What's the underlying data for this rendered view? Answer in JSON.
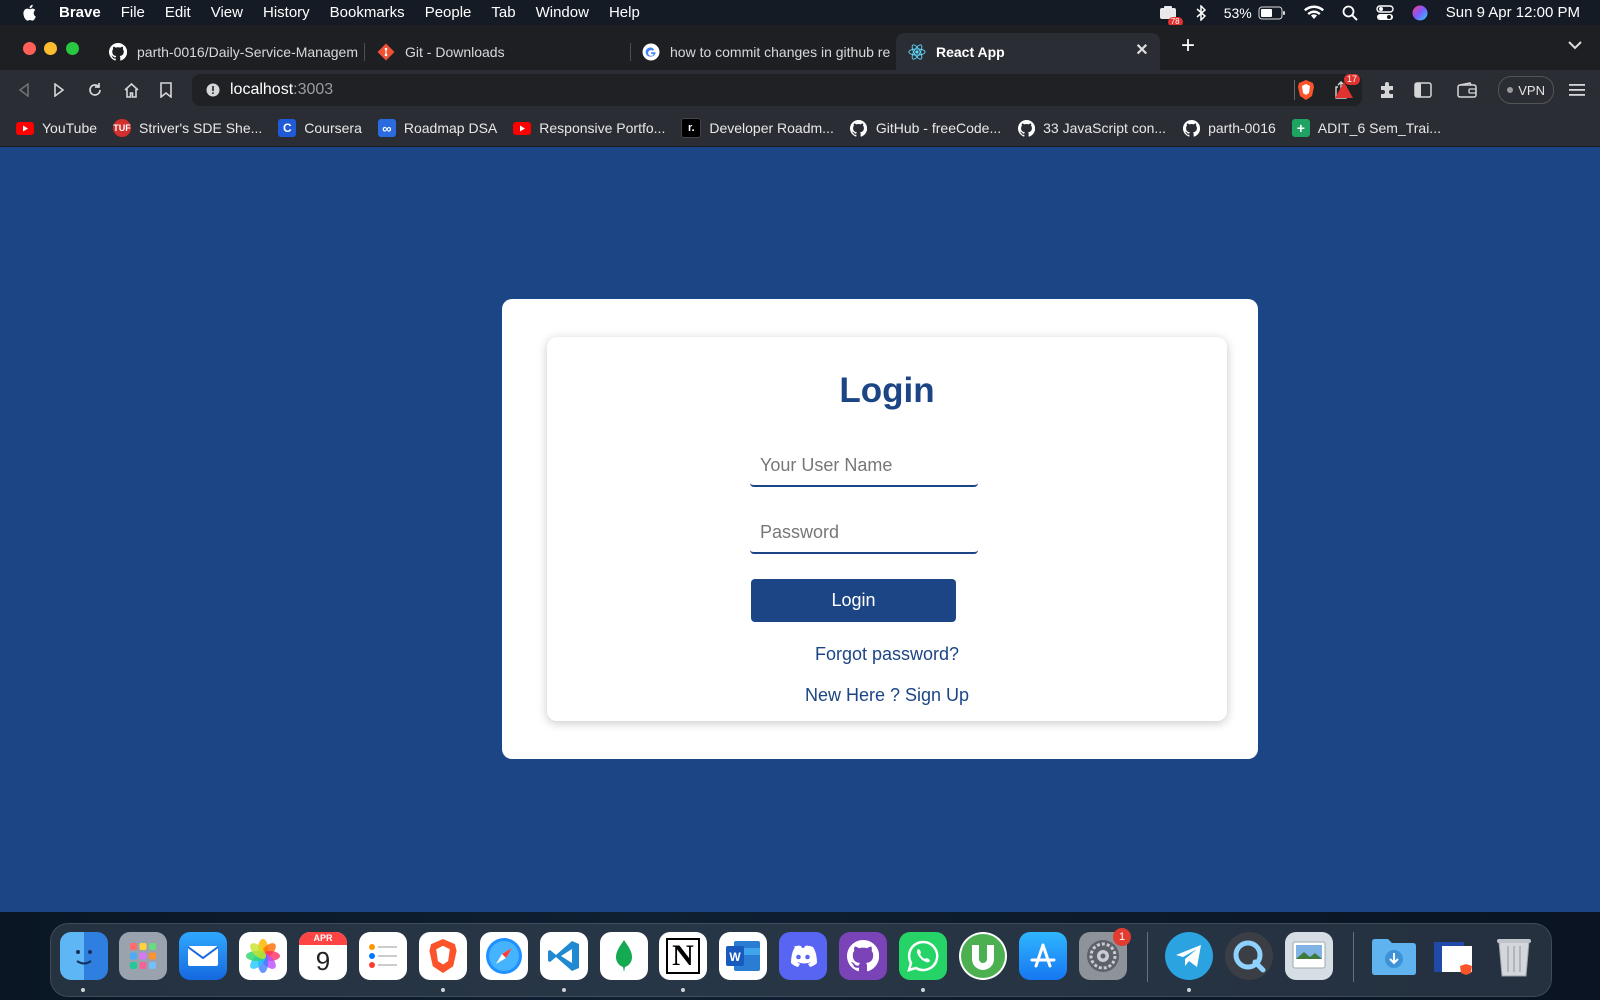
{
  "menubar": {
    "app_name": "Brave",
    "items": [
      "File",
      "Edit",
      "View",
      "History",
      "Bookmarks",
      "People",
      "Tab",
      "Window",
      "Help"
    ],
    "battery_percent": "53%",
    "clock": "Sun 9 Apr  12:00 PM",
    "notification_badge": "78"
  },
  "tabs": [
    {
      "title": "parth-0016/Daily-Service-Managem",
      "icon": "github-icon"
    },
    {
      "title": "Git - Downloads",
      "icon": "git-icon"
    },
    {
      "title": "how to commit changes in github re",
      "icon": "google-icon"
    },
    {
      "title": "React App",
      "icon": "react-icon",
      "active": true
    }
  ],
  "toolbar": {
    "url_host": "localhost",
    "url_port": ":3003",
    "shields_badge": "17",
    "vpn_label": "VPN"
  },
  "bookmarks": [
    {
      "label": "YouTube",
      "icon": "youtube-icon",
      "color": "#ff0000"
    },
    {
      "label": "Striver's SDE She...",
      "icon": "tuf-icon",
      "color": "#d32f2f",
      "icon_text": "TUF"
    },
    {
      "label": "Coursera",
      "icon": "coursera-icon",
      "color": "#1f5bd6",
      "icon_text": "C"
    },
    {
      "label": "Roadmap DSA",
      "icon": "infinity-icon",
      "color": "#2a6be0",
      "icon_text": "∞"
    },
    {
      "label": "Responsive Portfo...",
      "icon": "youtube-icon",
      "color": "#ff0000"
    },
    {
      "label": "Developer Roadm...",
      "icon": "roadmap-icon",
      "color": "#000000",
      "icon_text": "r."
    },
    {
      "label": "GitHub - freeCode...",
      "icon": "github-icon",
      "color": "#ffffff"
    },
    {
      "label": "33 JavaScript con...",
      "icon": "github-icon",
      "color": "#ffffff"
    },
    {
      "label": "parth-0016",
      "icon": "github-icon",
      "color": "#ffffff"
    },
    {
      "label": "ADIT_6 Sem_Trai...",
      "icon": "sheets-icon",
      "color": "#1ea362",
      "icon_text": "+"
    }
  ],
  "login": {
    "title": "Login",
    "username_placeholder": "Your User Name",
    "password_placeholder": "Password",
    "button_label": "Login",
    "forgot_link": "Forgot password?",
    "signup_link": "New Here ? Sign Up"
  },
  "dock": {
    "calendar_month": "APR",
    "calendar_day": "9",
    "settings_badge": "1",
    "items": [
      "finder-icon",
      "launchpad-icon",
      "mail-icon",
      "photos-icon",
      "calendar-icon",
      "reminders-icon",
      "brave-icon",
      "safari-icon",
      "vscode-icon",
      "mongodb-icon",
      "notion-icon",
      "word-icon",
      "discord-icon",
      "github-desktop-icon",
      "whatsapp-icon",
      "utorrent-icon",
      "app-store-icon",
      "system-settings-icon",
      "telegram-icon",
      "quicktime-icon",
      "preview-icon",
      "downloads-folder-icon",
      "document-stack-icon",
      "trash-icon"
    ]
  },
  "colors": {
    "page_background": "#1c4585",
    "accent": "#1c4585"
  }
}
